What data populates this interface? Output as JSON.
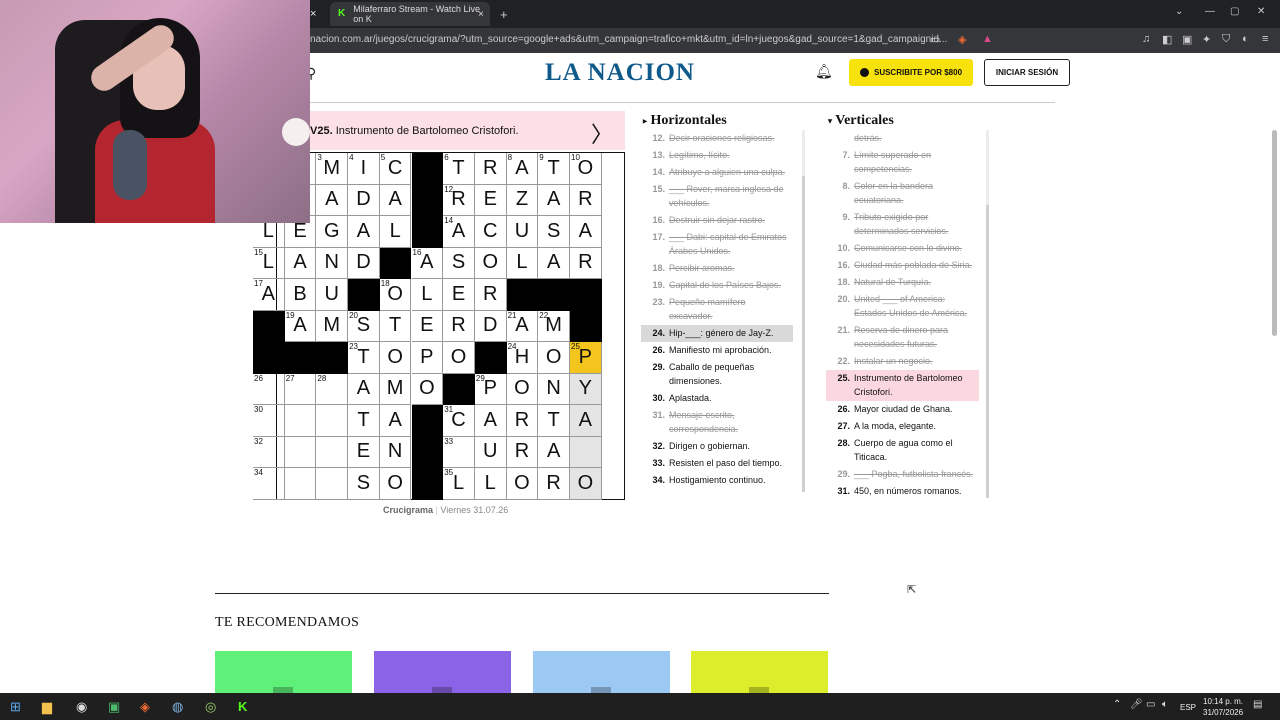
{
  "browser": {
    "tab_title": "Milaferraro Stream - Watch Live on K",
    "tab_close": "×",
    "new_tab": "+",
    "url": "nacion.com.ar/juegos/crucigrama/?utm_source=google+ads&utm_campaign=trafico+mkt&utm_id=ln+juegos&gad_source=1&gad_campaignid..."
  },
  "header": {
    "logo": "LA NACION",
    "subscribe_label": "SUSCRIBITE POR $800",
    "login_label": "INICIAR SESIÓN"
  },
  "current_clue": {
    "id": "V25.",
    "text": "Instrumento de Bartolomeo Cristofori.",
    "next_arrow": "〉"
  },
  "grid": {
    "rows": [
      [
        "O",
        "M",
        "I",
        "C",
        "#",
        "T",
        "R",
        "A",
        "T",
        "O"
      ],
      [
        "T",
        "A",
        "D",
        "A",
        "#",
        "R",
        "E",
        "Z",
        "A",
        "R"
      ],
      [
        "L",
        "E",
        "G",
        "A",
        "L",
        "#",
        "A",
        "C",
        "U",
        "S",
        "A"
      ],
      [
        "L",
        "A",
        "N",
        "D",
        "#",
        "A",
        "S",
        "O",
        "L",
        "A",
        "R"
      ],
      [
        "A",
        "B",
        "U",
        "#",
        "O",
        "L",
        "E",
        "R",
        "#",
        "#"
      ],
      [
        "#",
        "A",
        "M",
        "S",
        "T",
        "E",
        "R",
        "D",
        "A",
        "M",
        "#"
      ],
      [
        "#",
        "#",
        "#",
        "T",
        "O",
        "P",
        "O",
        "#",
        "H",
        "O",
        "P"
      ],
      [
        "",
        "",
        "",
        "A",
        "M",
        "O",
        "#",
        "P",
        "O",
        "N",
        "Y"
      ],
      [
        "",
        "",
        "",
        "T",
        "A",
        "#",
        "C",
        "A",
        "R",
        "T",
        "A"
      ],
      [
        "",
        "",
        "",
        "E",
        "N",
        "#",
        "",
        "U",
        "R",
        "A",
        ""
      ],
      [
        "",
        "",
        "",
        "S",
        "O",
        "#",
        "L",
        "L",
        "O",
        "R",
        "O"
      ]
    ]
  },
  "grid_caption": {
    "name": "Crucigrama",
    "date": "Viernes 31.07.26"
  },
  "horizontales": {
    "title": "Horizontales",
    "clues": [
      {
        "n": "12.",
        "text": "Decir oraciones religiosas.",
        "state": "done"
      },
      {
        "n": "13.",
        "text": "Legítimo, lícito.",
        "state": "done"
      },
      {
        "n": "14.",
        "text": "Atribuye a alguien una culpa.",
        "state": "done"
      },
      {
        "n": "15.",
        "text": "___ Rover, marca inglesa de vehículos.",
        "state": "done"
      },
      {
        "n": "16.",
        "text": "Destruir sin dejar rastro.",
        "state": "done"
      },
      {
        "n": "17.",
        "text": "___ Dabi: capital de Emiratos Árabes Unidos.",
        "state": "done"
      },
      {
        "n": "18.",
        "text": "Percibir aromas.",
        "state": "done"
      },
      {
        "n": "19.",
        "text": "Capital de los Países Bajos.",
        "state": "done"
      },
      {
        "n": "23.",
        "text": "Pequeño mamífero excavador.",
        "state": "done"
      },
      {
        "n": "24.",
        "text": "Hip-___: género de Jay-Z.",
        "state": "dim"
      },
      {
        "n": "26.",
        "text": "Manifiesto mi aprobación.",
        "state": ""
      },
      {
        "n": "29.",
        "text": "Caballo de pequeñas dimensiones.",
        "state": ""
      },
      {
        "n": "30.",
        "text": "Aplastada.",
        "state": ""
      },
      {
        "n": "31.",
        "text": "Mensaje escrito, correspondencia.",
        "state": "done"
      },
      {
        "n": "32.",
        "text": "Dirigen o gobiernan.",
        "state": ""
      },
      {
        "n": "33.",
        "text": "Resisten el paso del tiempo.",
        "state": ""
      },
      {
        "n": "34.",
        "text": "Hostigamiento continuo.",
        "state": ""
      }
    ]
  },
  "verticales": {
    "title": "Verticales",
    "clues": [
      {
        "n": "",
        "text": "detrás.",
        "state": "done"
      },
      {
        "n": "7.",
        "text": "Límite superado en competencias.",
        "state": "done"
      },
      {
        "n": "8.",
        "text": "Color en la bandera ecuatoriana.",
        "state": "done"
      },
      {
        "n": "9.",
        "text": "Tributo exigido por determinados servicios.",
        "state": "done"
      },
      {
        "n": "10.",
        "text": "Comunicarse con lo divino.",
        "state": "done"
      },
      {
        "n": "16.",
        "text": "Ciudad más poblada de Siria.",
        "state": "done"
      },
      {
        "n": "18.",
        "text": "Natural de Turquía.",
        "state": "done"
      },
      {
        "n": "20.",
        "text": "United ___ of America: Estados Unidos de América.",
        "state": "done"
      },
      {
        "n": "21.",
        "text": "Reserva de dinero para necesidades futuras.",
        "state": "done"
      },
      {
        "n": "22.",
        "text": "Instalar un negocio.",
        "state": "done"
      },
      {
        "n": "25.",
        "text": "Instrumento de Bartolomeo Cristofori.",
        "state": "active"
      },
      {
        "n": "26.",
        "text": "Mayor ciudad de Ghana.",
        "state": ""
      },
      {
        "n": "27.",
        "text": "A la moda, elegante.",
        "state": ""
      },
      {
        "n": "28.",
        "text": "Cuerpo de agua como el Titicaca.",
        "state": ""
      },
      {
        "n": "29.",
        "text": "___ Pogba, futbolista francés.",
        "state": "done"
      },
      {
        "n": "31.",
        "text": "450, en números romanos.",
        "state": ""
      }
    ]
  },
  "recommend": {
    "title": "TE RECOMENDAMOS",
    "colors": [
      "#5ff07a",
      "#8a63e6",
      "#9cc9f4",
      "#dcee2b"
    ]
  },
  "taskbar": {
    "lang": "ESP",
    "time": "10:14 p. m.",
    "date": "31/07/2026"
  }
}
